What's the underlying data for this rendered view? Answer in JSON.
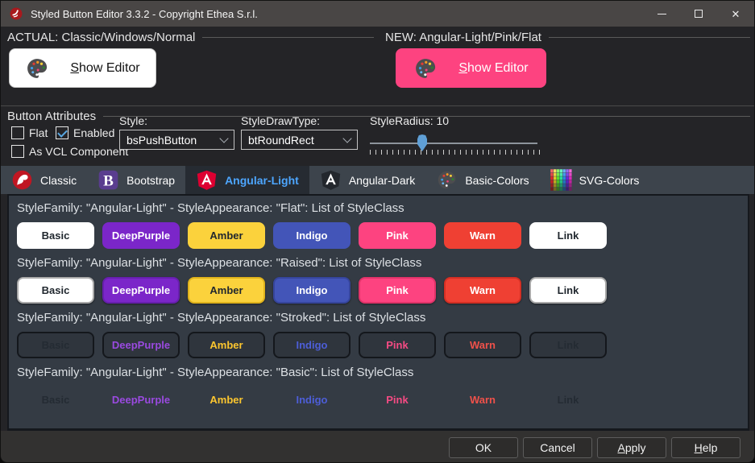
{
  "window": {
    "title": "Styled Button Editor 3.3.2 - Copyright Ethea S.r.l."
  },
  "actual_group": {
    "label": "ACTUAL: Classic/Windows/Normal",
    "show_editor": {
      "text": "Show Editor",
      "mnemonic": "S"
    }
  },
  "new_group": {
    "label": "NEW: Angular-Light/Pink/Flat",
    "show_editor": {
      "text": "Show Editor",
      "mnemonic": "S"
    },
    "accent_color": "#fd4380"
  },
  "attributes": {
    "label": "Button Attributes",
    "checkboxes": [
      {
        "label": "Flat",
        "checked": false
      },
      {
        "label": "Enabled",
        "checked": true
      },
      {
        "label": "As VCL Component",
        "checked": false
      }
    ],
    "style": {
      "label": "Style:",
      "value": "bsPushButton"
    },
    "draw_type": {
      "label": "StyleDrawType:",
      "value": "btRoundRect"
    },
    "radius": {
      "label": "StyleRadius: 10",
      "value": 10,
      "thumb_color": "#5f9fd6"
    }
  },
  "tabs": [
    {
      "label": "Classic",
      "icon": "delphi-icon",
      "selected": false
    },
    {
      "label": "Bootstrap",
      "icon": "bootstrap-icon",
      "selected": false
    },
    {
      "label": "Angular-Light",
      "icon": "angular-light-icon",
      "selected": true
    },
    {
      "label": "Angular-Dark",
      "icon": "angular-dark-icon",
      "selected": false
    },
    {
      "label": "Basic-Colors",
      "icon": "basic-colors-icon",
      "selected": false
    },
    {
      "label": "SVG-Colors",
      "icon": "svg-colors-icon",
      "selected": false
    }
  ],
  "selected_tab_color": "#4da6ff",
  "sections": [
    {
      "title": "StyleFamily: \"Angular-Light\" - StyleAppearance: \"Flat\": List of StyleClass",
      "appearance": "flat"
    },
    {
      "title": "StyleFamily: \"Angular-Light\" - StyleAppearance: \"Raised\": List of StyleClass",
      "appearance": "raised"
    },
    {
      "title": "StyleFamily: \"Angular-Light\" - StyleAppearance: \"Stroked\": List of StyleClass",
      "appearance": "stroked"
    },
    {
      "title": "StyleFamily: \"Angular-Light\" - StyleAppearance: \"Basic\": List of StyleClass",
      "appearance": "basic"
    }
  ],
  "style_classes": [
    {
      "name": "Basic",
      "fill": "#ffffff",
      "text_on_fill": "#1f262d",
      "raised_border": "#a9a9a9",
      "label_color": "#242b33"
    },
    {
      "name": "DeepPurple",
      "fill": "#7b26c9",
      "text_on_fill": "#ffffff",
      "raised_border": "#671fae",
      "label_color": "#9a4ae0"
    },
    {
      "name": "Amber",
      "fill": "#fbd23c",
      "text_on_fill": "#21272e",
      "raised_border": "#dfb21c",
      "label_color": "#fcc62f"
    },
    {
      "name": "Indigo",
      "fill": "#4355b8",
      "text_on_fill": "#ffffff",
      "raised_border": "#36459c",
      "label_color": "#4d5ed8"
    },
    {
      "name": "Pink",
      "fill": "#fd4380",
      "text_on_fill": "#ffffff",
      "raised_border": "#e03369",
      "label_color": "#f64b84"
    },
    {
      "name": "Warn",
      "fill": "#ef4033",
      "text_on_fill": "#ffffff",
      "raised_border": "#d32f24",
      "label_color": "#f0514a"
    },
    {
      "name": "Link",
      "fill": "#ffffff",
      "text_on_fill": "#1f262d",
      "raised_border": "#a9a9a9",
      "label_color": "#242b33"
    }
  ],
  "footer": {
    "ok": {
      "text": "OK"
    },
    "cancel": {
      "text": "Cancel"
    },
    "apply": {
      "text": "Apply",
      "mnemonic": "A"
    },
    "help": {
      "text": "Help",
      "mnemonic": "H"
    }
  }
}
